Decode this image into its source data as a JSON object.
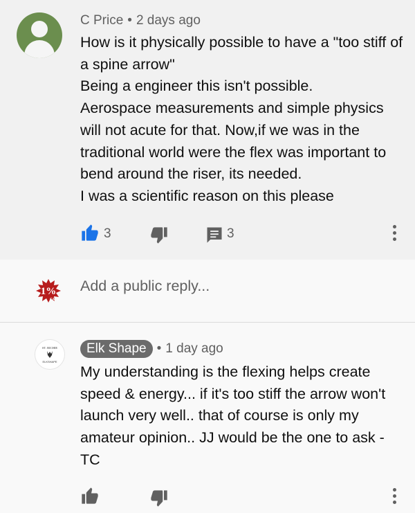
{
  "comment": {
    "author": "C Price",
    "time": "2 days ago",
    "text": "How is it physically possible to have a \"too stiff of a spine arrow\"\nBeing a engineer this isn't possible.\nAerospace measurements and simple physics will not acute for that. Now,if we was in the traditional world were the flex was important to bend around the riser, its needed.\nI was a scientific reason on this please",
    "likes": "3",
    "replies": "3",
    "avatar_color": "#6b8e4e"
  },
  "reply_box": {
    "placeholder": "Add a public reply...",
    "avatar_label": "1%",
    "avatar_sub": "CALM"
  },
  "reply": {
    "author": "Elk Shape",
    "time": "1 day ago",
    "text": "My understanding is the flexing helps create speed & energy... if it's too stiff the arrow won't launch very well.. that of course is only my amateur opinion.. JJ would be the one to ask - TC",
    "avatar_top": "ST. RICHIE",
    "avatar_bottom": "ELKSHAPE"
  },
  "colors": {
    "like_active": "#1a73e8",
    "icon_gray": "#606060"
  }
}
